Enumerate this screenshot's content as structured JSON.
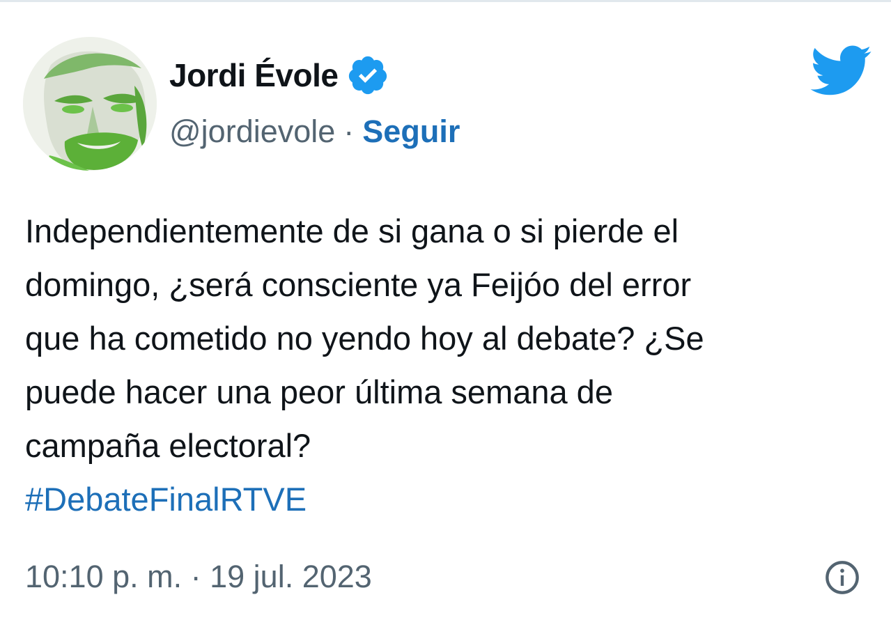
{
  "author": {
    "display_name": "Jordi Évole",
    "handle": "@jordievole",
    "separator": "·",
    "follow_label": "Seguir",
    "verified_icon": "verified-badge-icon",
    "avatar_icon": "profile-photo"
  },
  "tweet": {
    "lines": [
      "Independientemente de si gana o si pierde el",
      "domingo, ¿será consciente ya Feijóo del error",
      "que ha cometido no yendo hoy al debate? ¿Se",
      "puede hacer una peor última semana de",
      "campaña electoral?"
    ],
    "hashtag": "#DebateFinalRTVE"
  },
  "meta": {
    "timestamp": "10:10 p. m. · 19 jul. 2023",
    "info_icon": "info-icon",
    "brand_icon": "twitter-bird-icon"
  },
  "colors": {
    "brand": "#1d9bf0",
    "link": "#1d6fb8",
    "text": "#0f1419",
    "secondary": "#536471",
    "avatar_green": "#6cc24a"
  }
}
